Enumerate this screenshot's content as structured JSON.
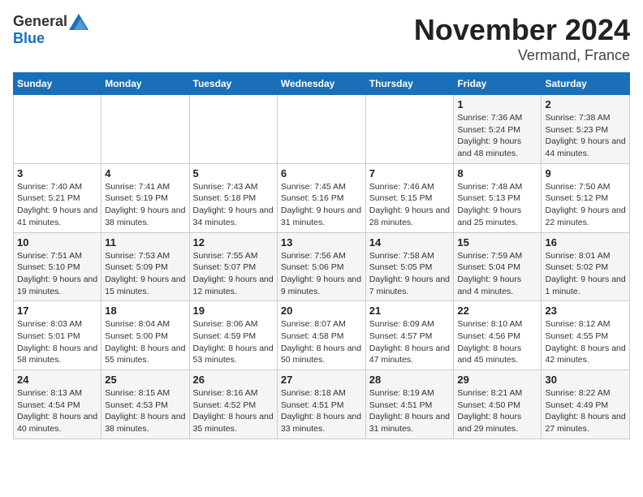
{
  "header": {
    "logo_general": "General",
    "logo_blue": "Blue",
    "month": "November 2024",
    "location": "Vermand, France"
  },
  "weekdays": [
    "Sunday",
    "Monday",
    "Tuesday",
    "Wednesday",
    "Thursday",
    "Friday",
    "Saturday"
  ],
  "weeks": [
    [
      {
        "day": "",
        "info": ""
      },
      {
        "day": "",
        "info": ""
      },
      {
        "day": "",
        "info": ""
      },
      {
        "day": "",
        "info": ""
      },
      {
        "day": "",
        "info": ""
      },
      {
        "day": "1",
        "info": "Sunrise: 7:36 AM\nSunset: 5:24 PM\nDaylight: 9 hours and 48 minutes."
      },
      {
        "day": "2",
        "info": "Sunrise: 7:38 AM\nSunset: 5:23 PM\nDaylight: 9 hours and 44 minutes."
      }
    ],
    [
      {
        "day": "3",
        "info": "Sunrise: 7:40 AM\nSunset: 5:21 PM\nDaylight: 9 hours and 41 minutes."
      },
      {
        "day": "4",
        "info": "Sunrise: 7:41 AM\nSunset: 5:19 PM\nDaylight: 9 hours and 38 minutes."
      },
      {
        "day": "5",
        "info": "Sunrise: 7:43 AM\nSunset: 5:18 PM\nDaylight: 9 hours and 34 minutes."
      },
      {
        "day": "6",
        "info": "Sunrise: 7:45 AM\nSunset: 5:16 PM\nDaylight: 9 hours and 31 minutes."
      },
      {
        "day": "7",
        "info": "Sunrise: 7:46 AM\nSunset: 5:15 PM\nDaylight: 9 hours and 28 minutes."
      },
      {
        "day": "8",
        "info": "Sunrise: 7:48 AM\nSunset: 5:13 PM\nDaylight: 9 hours and 25 minutes."
      },
      {
        "day": "9",
        "info": "Sunrise: 7:50 AM\nSunset: 5:12 PM\nDaylight: 9 hours and 22 minutes."
      }
    ],
    [
      {
        "day": "10",
        "info": "Sunrise: 7:51 AM\nSunset: 5:10 PM\nDaylight: 9 hours and 19 minutes."
      },
      {
        "day": "11",
        "info": "Sunrise: 7:53 AM\nSunset: 5:09 PM\nDaylight: 9 hours and 15 minutes."
      },
      {
        "day": "12",
        "info": "Sunrise: 7:55 AM\nSunset: 5:07 PM\nDaylight: 9 hours and 12 minutes."
      },
      {
        "day": "13",
        "info": "Sunrise: 7:56 AM\nSunset: 5:06 PM\nDaylight: 9 hours and 9 minutes."
      },
      {
        "day": "14",
        "info": "Sunrise: 7:58 AM\nSunset: 5:05 PM\nDaylight: 9 hours and 7 minutes."
      },
      {
        "day": "15",
        "info": "Sunrise: 7:59 AM\nSunset: 5:04 PM\nDaylight: 9 hours and 4 minutes."
      },
      {
        "day": "16",
        "info": "Sunrise: 8:01 AM\nSunset: 5:02 PM\nDaylight: 9 hours and 1 minute."
      }
    ],
    [
      {
        "day": "17",
        "info": "Sunrise: 8:03 AM\nSunset: 5:01 PM\nDaylight: 8 hours and 58 minutes."
      },
      {
        "day": "18",
        "info": "Sunrise: 8:04 AM\nSunset: 5:00 PM\nDaylight: 8 hours and 55 minutes."
      },
      {
        "day": "19",
        "info": "Sunrise: 8:06 AM\nSunset: 4:59 PM\nDaylight: 8 hours and 53 minutes."
      },
      {
        "day": "20",
        "info": "Sunrise: 8:07 AM\nSunset: 4:58 PM\nDaylight: 8 hours and 50 minutes."
      },
      {
        "day": "21",
        "info": "Sunrise: 8:09 AM\nSunset: 4:57 PM\nDaylight: 8 hours and 47 minutes."
      },
      {
        "day": "22",
        "info": "Sunrise: 8:10 AM\nSunset: 4:56 PM\nDaylight: 8 hours and 45 minutes."
      },
      {
        "day": "23",
        "info": "Sunrise: 8:12 AM\nSunset: 4:55 PM\nDaylight: 8 hours and 42 minutes."
      }
    ],
    [
      {
        "day": "24",
        "info": "Sunrise: 8:13 AM\nSunset: 4:54 PM\nDaylight: 8 hours and 40 minutes."
      },
      {
        "day": "25",
        "info": "Sunrise: 8:15 AM\nSunset: 4:53 PM\nDaylight: 8 hours and 38 minutes."
      },
      {
        "day": "26",
        "info": "Sunrise: 8:16 AM\nSunset: 4:52 PM\nDaylight: 8 hours and 35 minutes."
      },
      {
        "day": "27",
        "info": "Sunrise: 8:18 AM\nSunset: 4:51 PM\nDaylight: 8 hours and 33 minutes."
      },
      {
        "day": "28",
        "info": "Sunrise: 8:19 AM\nSunset: 4:51 PM\nDaylight: 8 hours and 31 minutes."
      },
      {
        "day": "29",
        "info": "Sunrise: 8:21 AM\nSunset: 4:50 PM\nDaylight: 8 hours and 29 minutes."
      },
      {
        "day": "30",
        "info": "Sunrise: 8:22 AM\nSunset: 4:49 PM\nDaylight: 8 hours and 27 minutes."
      }
    ]
  ]
}
